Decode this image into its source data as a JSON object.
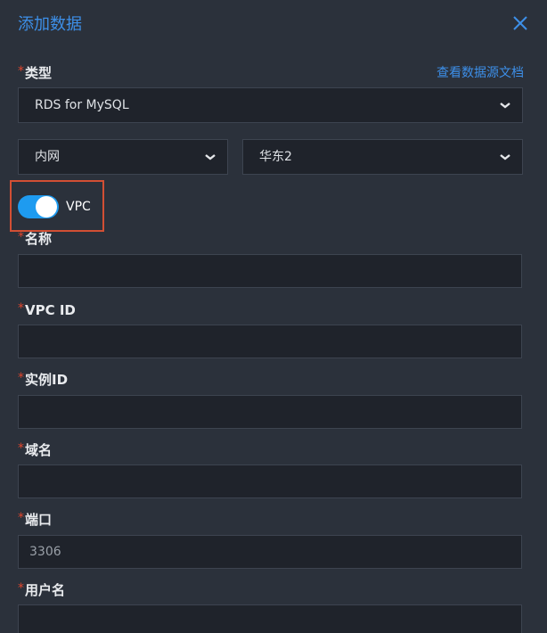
{
  "dialog": {
    "title": "添加数据",
    "close_icon": "close-x-icon",
    "accent_color": "#3d8fe8"
  },
  "type_field": {
    "label": "类型",
    "required": "*",
    "doc_link": "查看数据源文档",
    "selected": "RDS for MySQL"
  },
  "network_select": {
    "selected": "内网"
  },
  "region_select": {
    "selected": "华东2"
  },
  "vpc_toggle": {
    "label": "VPC",
    "on": true
  },
  "fields": {
    "name": {
      "label": "名称",
      "required": "*",
      "value": ""
    },
    "vpc_id": {
      "label": "VPC ID",
      "required": "*",
      "value": ""
    },
    "instance_id": {
      "label": "实例ID",
      "required": "*",
      "value": ""
    },
    "domain": {
      "label": "域名",
      "required": "*",
      "value": ""
    },
    "port": {
      "label": "端口",
      "required": "*",
      "value": "3306"
    },
    "username": {
      "label": "用户名",
      "required": "*",
      "value": ""
    }
  }
}
